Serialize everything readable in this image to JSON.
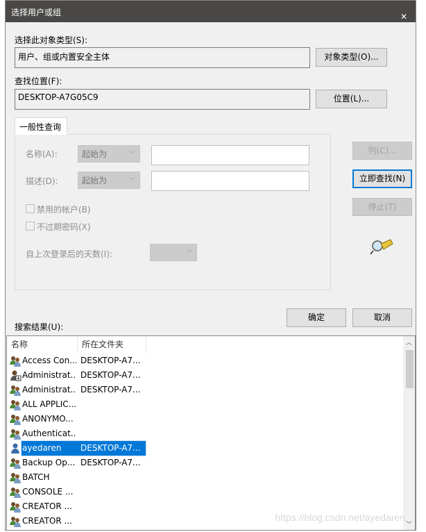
{
  "window": {
    "title": "选择用户或组",
    "close_icon": "close-icon"
  },
  "object_type": {
    "label": "选择此对象类型(S):",
    "value": "用户、组或内置安全主体",
    "button": "对象类型(O)..."
  },
  "location": {
    "label": "查找位置(F):",
    "value": "DESKTOP-A7G05C9",
    "button": "位置(L)..."
  },
  "tab": {
    "label": "一般性查询"
  },
  "query": {
    "name_label": "名称(A):",
    "name_mode": "起始为",
    "name_value": "",
    "desc_label": "描述(D):",
    "desc_mode": "起始为",
    "desc_value": "",
    "disabled_accounts": {
      "label": "禁用的帐户(B)",
      "checked": false
    },
    "non_expiring": {
      "label": "不过期密码(X)",
      "checked": false
    },
    "days_label": "自上次登录后的天数(I):",
    "days_value": ""
  },
  "buttons": {
    "columns": "列(C)...",
    "find_now": "立即查找(N)",
    "stop": "停止(T)",
    "ok": "确定",
    "cancel": "取消"
  },
  "results": {
    "label": "搜索结果(U):",
    "columns": [
      "名称",
      "所在文件夹"
    ],
    "rows": [
      {
        "name": "Access Con...",
        "folder": "DESKTOP-A7...",
        "icon": "group"
      },
      {
        "name": "Administrat...",
        "folder": "DESKTOP-A7...",
        "icon": "user-admin"
      },
      {
        "name": "Administrat...",
        "folder": "DESKTOP-A7...",
        "icon": "group"
      },
      {
        "name": "ALL APPLIC...",
        "folder": "",
        "icon": "group"
      },
      {
        "name": "ANONYMO...",
        "folder": "",
        "icon": "group"
      },
      {
        "name": "Authenticat...",
        "folder": "",
        "icon": "group"
      },
      {
        "name": "ayedaren",
        "folder": "DESKTOP-A7...",
        "icon": "user",
        "selected": true
      },
      {
        "name": "Backup Op...",
        "folder": "DESKTOP-A7...",
        "icon": "group"
      },
      {
        "name": "BATCH",
        "folder": "",
        "icon": "group"
      },
      {
        "name": "CONSOLE ...",
        "folder": "",
        "icon": "group"
      },
      {
        "name": "CREATOR ...",
        "folder": "",
        "icon": "group"
      },
      {
        "name": "CREATOR ...",
        "folder": "",
        "icon": "group"
      }
    ]
  },
  "watermark": "https://blog.csdn.net/ayedaren",
  "colors": {
    "titlebar": "#4a4846",
    "selection": "#0078d7",
    "focus": "#0078d7"
  }
}
